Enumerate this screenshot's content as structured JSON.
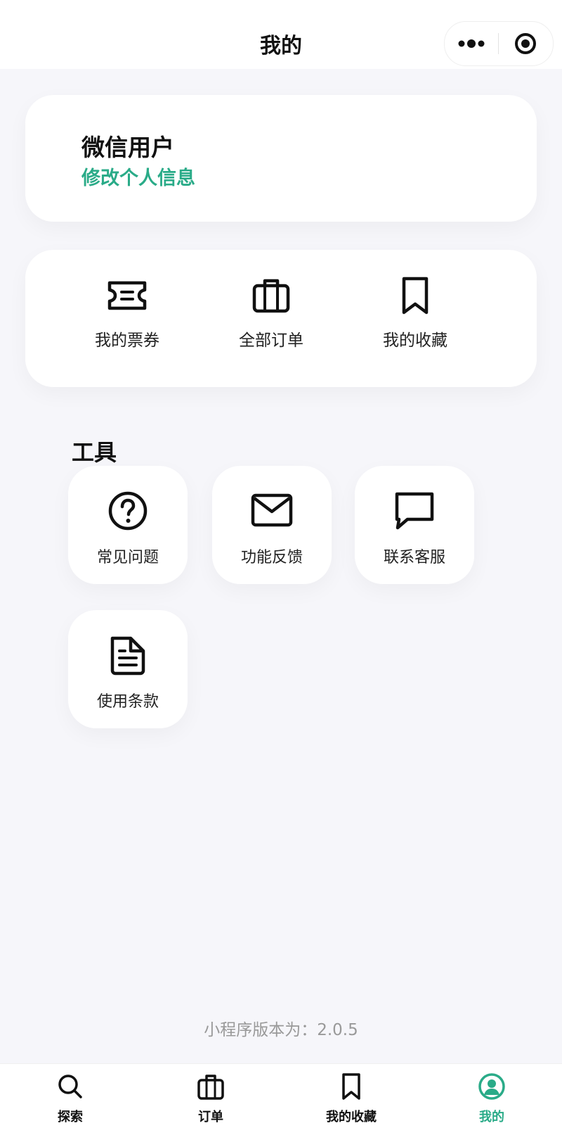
{
  "nav": {
    "title": "我的",
    "more_icon": "more-dots-icon",
    "close_icon": "target-circle-icon"
  },
  "profile": {
    "name": "微信用户",
    "edit_link": "修改个人信息"
  },
  "quick_actions": [
    {
      "label": "我的票券",
      "icon": "ticket-icon"
    },
    {
      "label": "全部订单",
      "icon": "briefcase-icon"
    },
    {
      "label": "我的收藏",
      "icon": "bookmark-icon"
    }
  ],
  "tools": {
    "title": "工具",
    "items": [
      {
        "label": "常见问题",
        "icon": "question-circle-icon"
      },
      {
        "label": "功能反馈",
        "icon": "mail-icon"
      },
      {
        "label": "联系客服",
        "icon": "chat-bubble-icon"
      },
      {
        "label": "使用条款",
        "icon": "document-icon"
      }
    ]
  },
  "footer": {
    "version_text": "小程序版本为：2.0.5"
  },
  "tabbar": {
    "items": [
      {
        "label": "探索",
        "icon": "search-icon",
        "active": false
      },
      {
        "label": "订单",
        "icon": "briefcase-icon",
        "active": false
      },
      {
        "label": "我的收藏",
        "icon": "bookmark-icon",
        "active": false
      },
      {
        "label": "我的",
        "icon": "user-circle-icon",
        "active": true
      }
    ]
  },
  "colors": {
    "accent": "#2aab88",
    "background": "#f6f6fa",
    "card": "#ffffff",
    "muted_text": "#999999"
  }
}
